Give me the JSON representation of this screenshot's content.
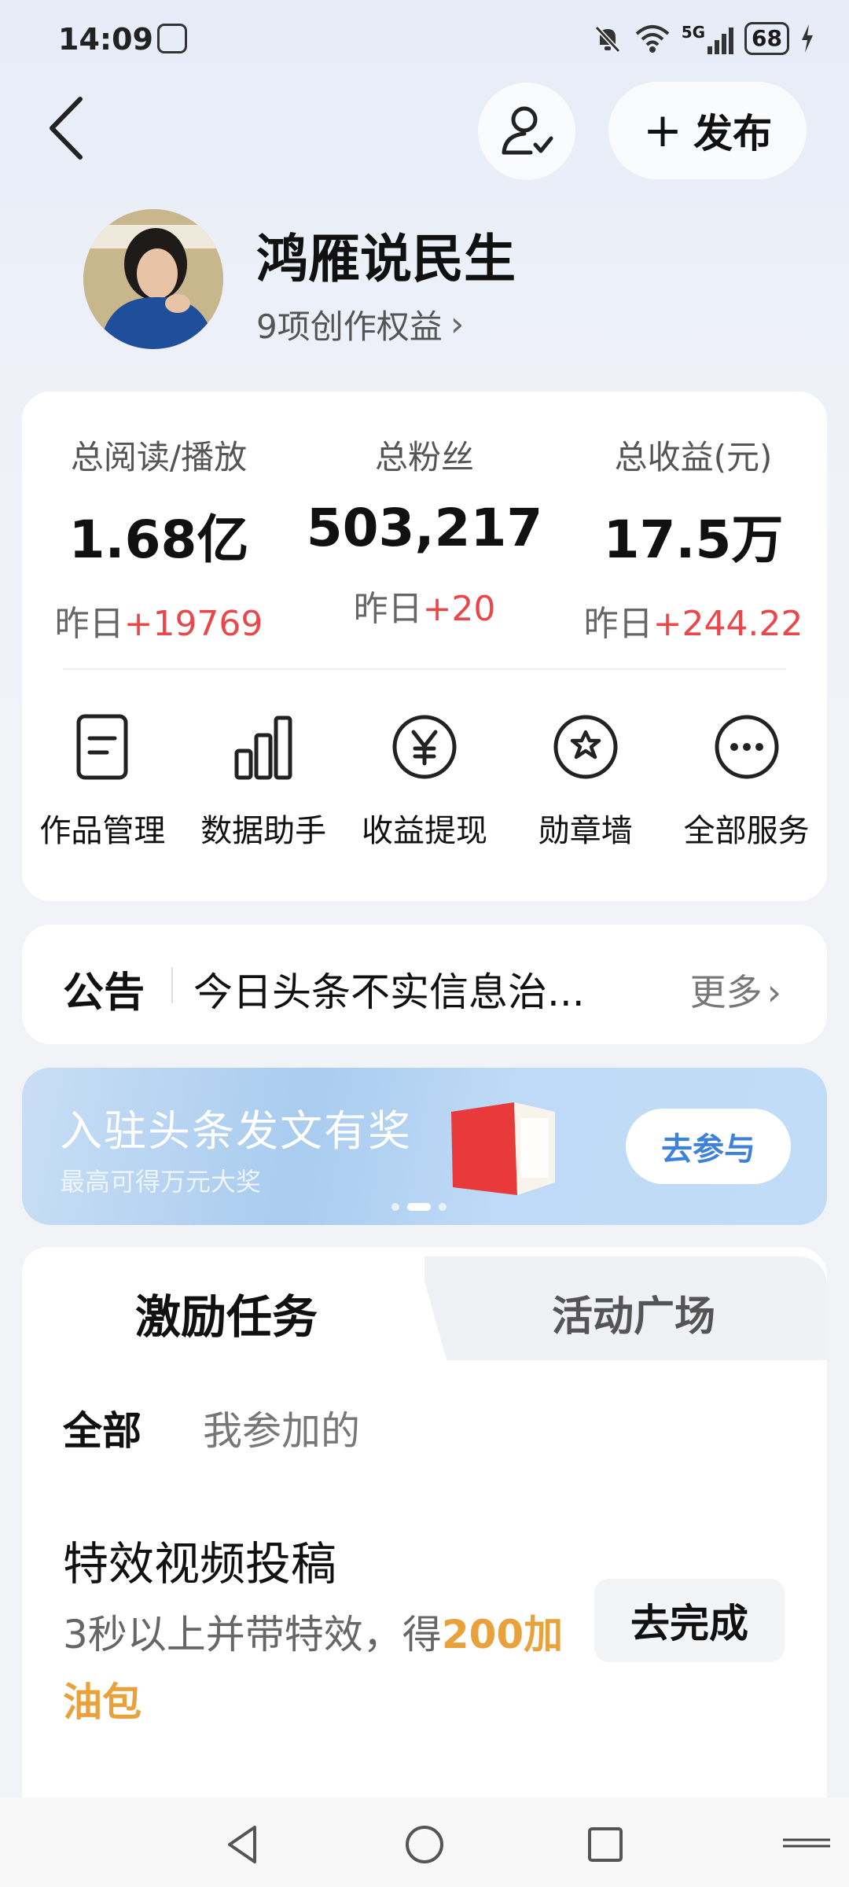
{
  "status_bar": {
    "time": "14:09",
    "network": "5G",
    "battery": "68"
  },
  "header": {
    "publish_label": "发布"
  },
  "profile": {
    "name": "鸿雁说民生",
    "benefits": "9项创作权益"
  },
  "stats": [
    {
      "label": "总阅读/播放",
      "value": "1.68亿",
      "delta_prefix": "昨日",
      "delta": "+19769"
    },
    {
      "label": "总粉丝",
      "value": "503,217",
      "delta_prefix": "昨日",
      "delta": "+20"
    },
    {
      "label": "总收益(元)",
      "value": "17.5万",
      "delta_prefix": "昨日",
      "delta": "+244.22"
    }
  ],
  "tools": [
    {
      "label": "作品管理",
      "icon": "document-icon"
    },
    {
      "label": "数据助手",
      "icon": "bar-chart-icon"
    },
    {
      "label": "收益提现",
      "icon": "yuan-icon"
    },
    {
      "label": "勋章墙",
      "icon": "medal-icon"
    },
    {
      "label": "全部服务",
      "icon": "more-icon"
    }
  ],
  "notice": {
    "tag": "公告",
    "text": "今日头条不实信息治...",
    "more": "更多"
  },
  "banner": {
    "title": "入驻头条发文有奖",
    "subtitle": "最高可得万元大奖",
    "button": "去参与"
  },
  "tasks": {
    "tabs": [
      "激励任务",
      "活动广场"
    ],
    "filters": [
      "全部",
      "我参加的"
    ],
    "item": {
      "title": "特效视频投稿",
      "desc_pre": "3秒以上并带特效，得",
      "desc_highlight": "200加油包",
      "button": "去完成"
    }
  },
  "colors": {
    "accent_red": "#e9474a",
    "highlight_orange": "#e9a23b",
    "button_blue": "#3d82d8"
  }
}
